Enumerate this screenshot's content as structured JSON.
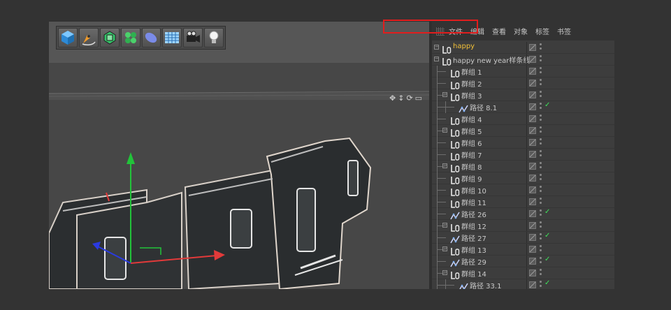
{
  "toolbar": {
    "buttons": [
      {
        "icon": "cube-icon"
      },
      {
        "icon": "pen-tool-icon"
      },
      {
        "icon": "subdivision-icon"
      },
      {
        "icon": "cloner-icon"
      },
      {
        "icon": "deformer-icon"
      },
      {
        "icon": "floor-grid-icon"
      },
      {
        "icon": "camera-icon"
      },
      {
        "icon": "light-bulb-icon"
      }
    ]
  },
  "viewport": {
    "nav_icons": [
      "✥",
      "↕",
      "⟳",
      "▭"
    ]
  },
  "object_manager": {
    "menu": [
      "文件",
      "编辑",
      "查看",
      "对象",
      "标签",
      "书签"
    ],
    "rows": [
      {
        "name": "happy",
        "type": "null",
        "level": 0,
        "expand": true,
        "check": false,
        "highlight": true
      },
      {
        "name": "happy new year样条线",
        "type": "null",
        "level": 0,
        "expand": true,
        "check": false
      },
      {
        "name": "群组 1",
        "type": "null",
        "level": 1,
        "expand": false,
        "check": false
      },
      {
        "name": "群组 2",
        "type": "null",
        "level": 1,
        "expand": false,
        "check": false
      },
      {
        "name": "群组 3",
        "type": "null",
        "level": 1,
        "expand": true,
        "check": false
      },
      {
        "name": "路径 8.1",
        "type": "spline",
        "level": 2,
        "expand": false,
        "check": true
      },
      {
        "name": "群组 4",
        "type": "null",
        "level": 1,
        "expand": false,
        "check": false
      },
      {
        "name": "群组 5",
        "type": "null",
        "level": 1,
        "expand": true,
        "check": false
      },
      {
        "name": "群组 6",
        "type": "null",
        "level": 1,
        "expand": false,
        "check": false
      },
      {
        "name": "群组 7",
        "type": "null",
        "level": 1,
        "expand": false,
        "check": false
      },
      {
        "name": "群组 8",
        "type": "null",
        "level": 1,
        "expand": true,
        "check": false
      },
      {
        "name": "群组 9",
        "type": "null",
        "level": 1,
        "expand": false,
        "check": false
      },
      {
        "name": "群组 10",
        "type": "null",
        "level": 1,
        "expand": false,
        "check": false
      },
      {
        "name": "群组 11",
        "type": "null",
        "level": 1,
        "expand": false,
        "check": false
      },
      {
        "name": "路径 26",
        "type": "spline",
        "level": 1,
        "expand": false,
        "check": true
      },
      {
        "name": "群组 12",
        "type": "null",
        "level": 1,
        "expand": true,
        "check": false
      },
      {
        "name": "路径 27",
        "type": "spline",
        "level": 1,
        "expand": false,
        "check": true
      },
      {
        "name": "群组 13",
        "type": "null",
        "level": 1,
        "expand": true,
        "check": false
      },
      {
        "name": "路径 29",
        "type": "spline",
        "level": 1,
        "expand": false,
        "check": true
      },
      {
        "name": "群组 14",
        "type": "null",
        "level": 1,
        "expand": true,
        "check": false
      },
      {
        "name": "路径 33.1",
        "type": "spline",
        "level": 2,
        "expand": false,
        "check": true
      }
    ]
  },
  "colors": {
    "highlight_text": "#f2c038",
    "selection_box": "#e11d1d",
    "check": "#3ee35a",
    "axis_y": "#22c33a",
    "axis_x": "#e23a3a",
    "axis_z": "#2a3ae0"
  }
}
